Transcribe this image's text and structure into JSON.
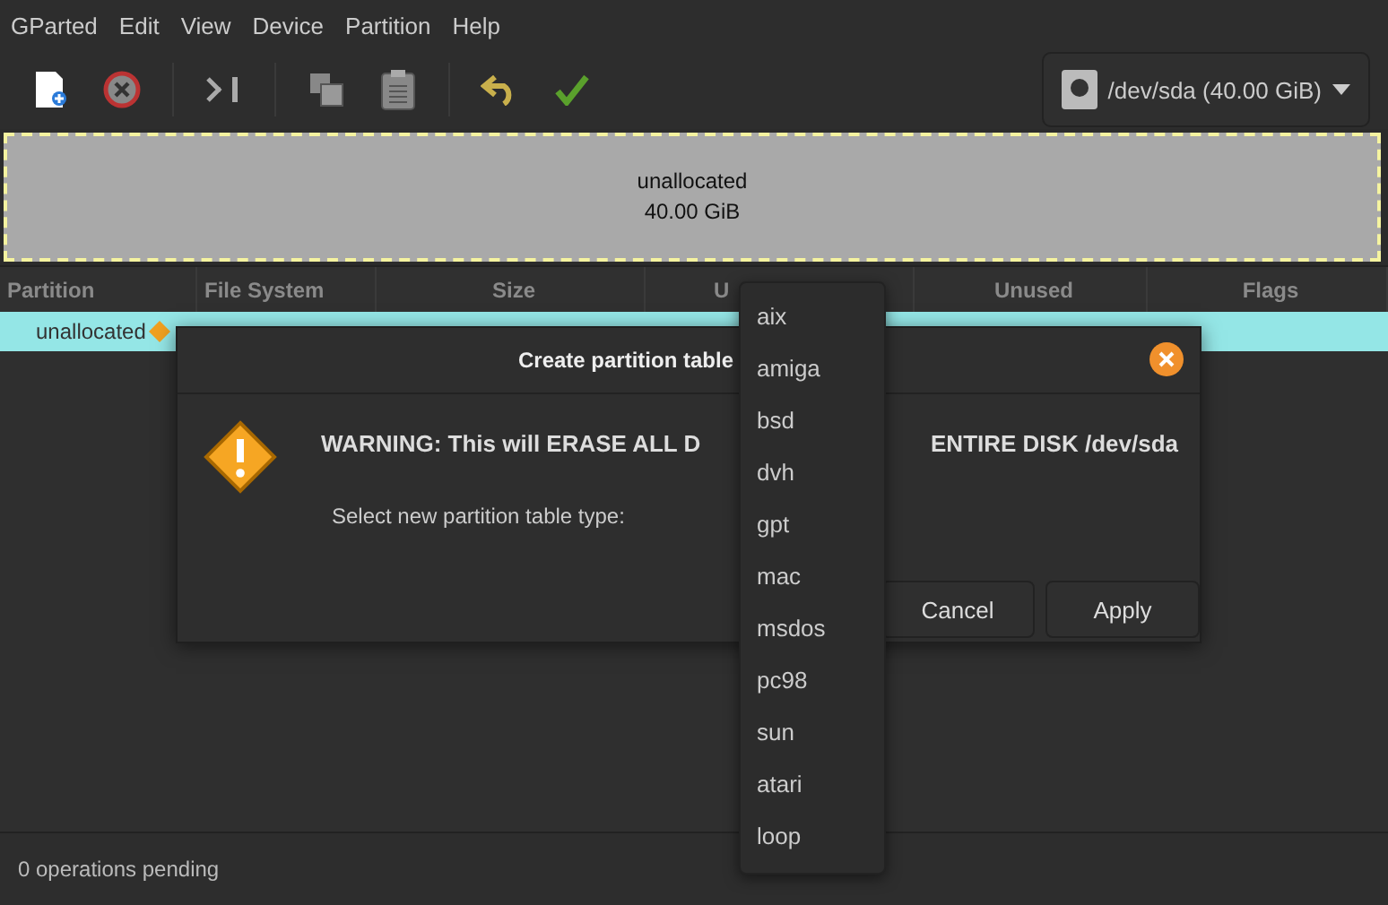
{
  "menu": [
    "GParted",
    "Edit",
    "View",
    "Device",
    "Partition",
    "Help"
  ],
  "device": {
    "label": "/dev/sda (40.00 GiB)"
  },
  "disk_map": {
    "name": "unallocated",
    "size": "40.00 GiB"
  },
  "columns": [
    "Partition",
    "File System",
    "Size",
    "U",
    "Unused",
    "Flags"
  ],
  "rows": [
    {
      "partition": "unallocated",
      "selected": true
    }
  ],
  "dialog": {
    "title": "Create partition table",
    "warning_left": "WARNING:  This will ERASE ALL D",
    "warning_right": "ENTIRE DISK /dev/sda",
    "label": "Select new partition table type:",
    "buttons": [
      "Cancel",
      "Apply"
    ]
  },
  "dropdown": [
    "aix",
    "amiga",
    "bsd",
    "dvh",
    "gpt",
    "mac",
    "msdos",
    "pc98",
    "sun",
    "atari",
    "loop"
  ],
  "status_bar": "0 operations pending"
}
